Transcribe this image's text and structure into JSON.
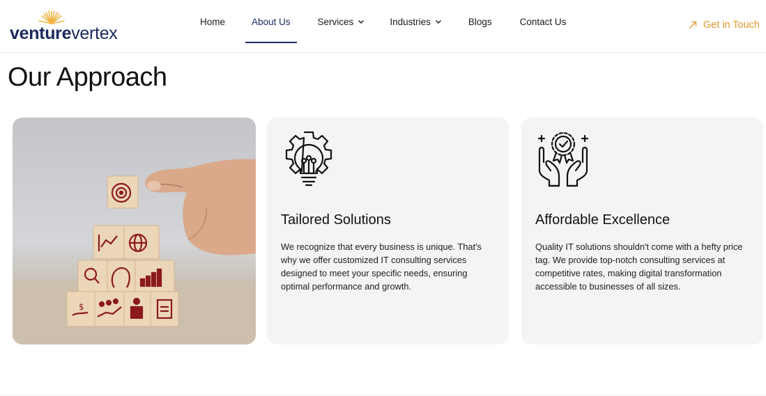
{
  "brand": {
    "logo_part1": "venture",
    "logo_part2": "vertex",
    "logo_color": "#1b2a5e",
    "sun_color": "#f0b445"
  },
  "nav": {
    "items": [
      {
        "label": "Home",
        "has_dropdown": false,
        "active": false
      },
      {
        "label": "About Us",
        "has_dropdown": false,
        "active": true
      },
      {
        "label": "Services",
        "has_dropdown": true,
        "active": false
      },
      {
        "label": "Industries",
        "has_dropdown": true,
        "active": false
      },
      {
        "label": "Blogs",
        "has_dropdown": false,
        "active": false
      },
      {
        "label": "Contact Us",
        "has_dropdown": false,
        "active": false
      }
    ],
    "cta_label": "Get in Touch",
    "cta_icon": "arrow-up-right-icon",
    "cta_color": "#e0962c"
  },
  "section": {
    "title": "Our Approach"
  },
  "cards": [
    {
      "icon": "lightbulb-gear-icon",
      "title": "Tailored Solutions",
      "body": "We recognize that every business is unique. That's why we offer customized IT consulting services designed to meet your specific needs, ensuring optimal performance and growth."
    },
    {
      "icon": "hands-award-icon",
      "title": "Affordable Excellence",
      "body": "Quality IT solutions shouldn't come with a hefty price tag. We provide top-notch consulting services at competitive rates, making digital transformation accessible to businesses of all sizes."
    }
  ],
  "colors": {
    "card_bg": "#f4f4f4",
    "block_icon_red": "#8b1a1a",
    "wood": "#e9d2b4"
  }
}
